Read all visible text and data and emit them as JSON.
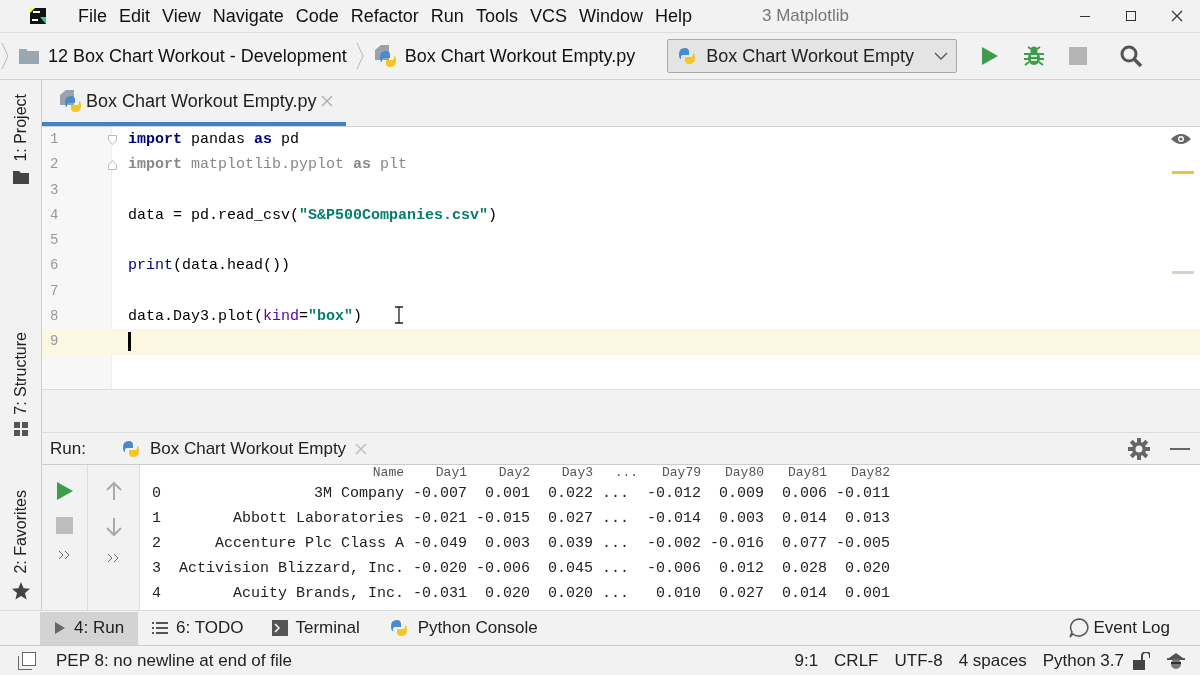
{
  "window": {
    "title": "3 Matplotlib"
  },
  "menu": [
    "File",
    "Edit",
    "View",
    "Navigate",
    "Code",
    "Refactor",
    "Run",
    "Tools",
    "VCS",
    "Window",
    "Help"
  ],
  "breadcrumbs": [
    {
      "label": "12 Box Chart Workout  - Development",
      "kind": "folder"
    },
    {
      "label": "Box Chart Workout Empty.py",
      "kind": "python-file"
    }
  ],
  "run_config": {
    "label": "Box Chart Workout Empty"
  },
  "toolbar": [
    {
      "kind": "run"
    },
    {
      "kind": "debug"
    },
    {
      "kind": "stop"
    },
    {
      "kind": "search"
    }
  ],
  "side_tabs": [
    {
      "label": "1: Project",
      "kind": "project"
    },
    {
      "label": "7: Structure",
      "kind": "structure"
    },
    {
      "label": "2: Favorites",
      "kind": "favorites"
    }
  ],
  "editor": {
    "tabs": [
      {
        "label": "Box Chart Workout Empty.py",
        "selected": true
      }
    ],
    "lines": [
      {
        "number": "1",
        "current": false,
        "tokens": [
          {
            "kind": "keyword",
            "text": "import"
          },
          {
            "kind": "plain",
            "text": " pandas "
          },
          {
            "kind": "keyword",
            "text": "as"
          },
          {
            "kind": "plain",
            "text": " pd"
          }
        ]
      },
      {
        "number": "2",
        "current": false,
        "tokens": [
          {
            "kind": "unused-keyword",
            "text": "import"
          },
          {
            "kind": "unused",
            "text": " matplotlib.pyplot "
          },
          {
            "kind": "unused-keyword",
            "text": "as"
          },
          {
            "kind": "unused",
            "text": " plt"
          }
        ]
      },
      {
        "number": "3",
        "current": false
      },
      {
        "number": "4",
        "current": false,
        "tokens": [
          {
            "kind": "plain",
            "text": "data = pd.read_csv("
          },
          {
            "kind": "string",
            "text": "\"S&P500Companies.csv\""
          },
          {
            "kind": "plain",
            "text": ")"
          }
        ]
      },
      {
        "number": "5",
        "current": false
      },
      {
        "number": "6",
        "current": false,
        "tokens": [
          {
            "kind": "builtin",
            "text": "print"
          },
          {
            "kind": "plain",
            "text": "(data.head())"
          }
        ]
      },
      {
        "number": "7",
        "current": false
      },
      {
        "number": "8",
        "current": false,
        "tokens": [
          {
            "kind": "plain",
            "text": "data.Day3.plot("
          },
          {
            "kind": "param",
            "text": "kind"
          },
          {
            "kind": "plain",
            "text": "="
          },
          {
            "kind": "string",
            "text": "\"box\""
          },
          {
            "kind": "plain",
            "text": ")"
          }
        ]
      },
      {
        "number": "9",
        "current": true
      }
    ]
  },
  "run_panel": {
    "label": "Run:",
    "tab": "Box Chart Workout Empty",
    "output": {
      "header": [
        "Name",
        "Day1",
        "Day2",
        "Day3",
        "...",
        "Day79",
        "Day80",
        "Day81",
        "Day82"
      ],
      "rows": [
        {
          "index": "0",
          "cells": [
            "3M Company",
            "-0.007",
            "0.001",
            "0.022",
            "...",
            "-0.012",
            "0.009",
            "0.006",
            "-0.011"
          ]
        },
        {
          "index": "1",
          "cells": [
            "Abbott Laboratories",
            "-0.021",
            "-0.015",
            "0.027",
            "...",
            "-0.014",
            "0.003",
            "0.014",
            "0.013"
          ]
        },
        {
          "index": "2",
          "cells": [
            "Accenture Plc Class A",
            "-0.049",
            "0.003",
            "0.039",
            "...",
            "-0.002",
            "-0.016",
            "0.077",
            "-0.005"
          ]
        },
        {
          "index": "3",
          "cells": [
            "Activision Blizzard, Inc.",
            "-0.020",
            "-0.006",
            "0.045",
            "...",
            "-0.006",
            "0.012",
            "0.028",
            "0.020"
          ]
        },
        {
          "index": "4",
          "cells": [
            "Acuity Brands, Inc.",
            "-0.031",
            "0.020",
            "0.020",
            "...",
            "0.010",
            "0.027",
            "0.014",
            "0.001"
          ]
        }
      ]
    }
  },
  "tool_tabs": [
    {
      "label": "4: Run",
      "kind": "run",
      "selected": true
    },
    {
      "label": "6: TODO",
      "kind": "todo",
      "selected": false
    },
    {
      "label": "Terminal",
      "kind": "terminal",
      "selected": false
    },
    {
      "label": "Python Console",
      "kind": "console",
      "selected": false
    }
  ],
  "event_log": "Event Log",
  "status_bar": {
    "message": "PEP 8: no newline at end of file",
    "items": [
      "9:1",
      "CRLF",
      "UTF-8",
      "4 spaces",
      "Python 3.7"
    ]
  }
}
